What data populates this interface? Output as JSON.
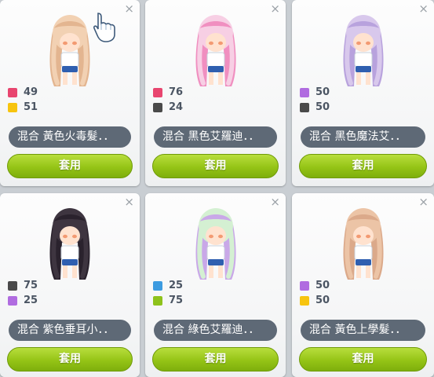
{
  "cards": [
    {
      "name": "混合  黃色火毒髮．．",
      "stats": [
        {
          "color": "#e8456f",
          "value": "49"
        },
        {
          "color": "#f7c40f",
          "value": "51"
        }
      ],
      "apply_label": "套用",
      "hair": "#f2d1b3",
      "hair2": "#e3b590"
    },
    {
      "name": "混合  黑色艾羅迪．．",
      "stats": [
        {
          "color": "#e8456f",
          "value": "76"
        },
        {
          "color": "#4a4a4a",
          "value": "24"
        }
      ],
      "apply_label": "套用",
      "hair": "#f7cfe4",
      "hair2": "#f08fc0"
    },
    {
      "name": "混合  黑色魔法艾．．",
      "stats": [
        {
          "color": "#b06ce0",
          "value": "50"
        },
        {
          "color": "#4a4a4a",
          "value": "50"
        }
      ],
      "apply_label": "套用",
      "hair": "#d8c8ec",
      "hair2": "#b8a2dd"
    },
    {
      "name": "混合  紫色垂耳小．．",
      "stats": [
        {
          "color": "#4a4a4a",
          "value": "75"
        },
        {
          "color": "#b06ce0",
          "value": "25"
        }
      ],
      "apply_label": "套用",
      "hair": "#3e3540",
      "hair2": "#2a222d"
    },
    {
      "name": "混合  綠色艾羅迪．．",
      "stats": [
        {
          "color": "#3c9be0",
          "value": "25"
        },
        {
          "color": "#8ec21b",
          "value": "75"
        }
      ],
      "apply_label": "套用",
      "hair": "#d4f0d2",
      "hair2": "#c9a8e8"
    },
    {
      "name": "混合  黃色上學髮．．",
      "stats": [
        {
          "color": "#b06ce0",
          "value": "50"
        },
        {
          "color": "#f7c40f",
          "value": "50"
        }
      ],
      "apply_label": "套用",
      "hair": "#ecc4a6",
      "hair2": "#dba98a"
    }
  ],
  "close_glyph": "×"
}
